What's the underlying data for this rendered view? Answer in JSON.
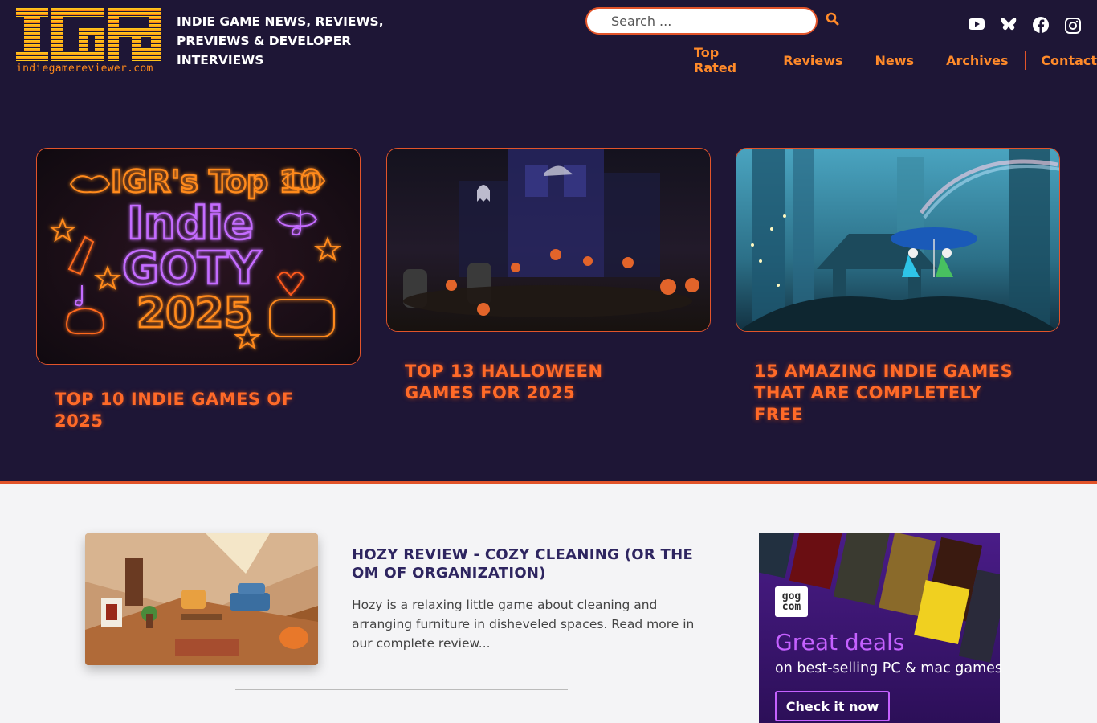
{
  "header": {
    "logo_letters": [
      "I",
      "G",
      "R"
    ],
    "logo_url": "indiegamereviewer.com",
    "tagline": "INDIE GAME NEWS, REVIEWS, PREVIEWS & DEVELOPER INTERVIEWS",
    "search_placeholder": "Search ...",
    "social": [
      "youtube-icon",
      "bluesky-icon",
      "facebook-icon",
      "instagram-icon"
    ],
    "nav": [
      "Top Rated",
      "Reviews",
      "News",
      "Archives",
      "Contact"
    ]
  },
  "features": [
    {
      "title": "TOP 10 INDIE GAMES OF 2025",
      "image_text": {
        "line1": "IGR's Top 10",
        "line2": "Indie",
        "line3": "GOTY",
        "line4": "2025"
      }
    },
    {
      "title": "TOP 13 HALLOWEEN GAMES FOR 2025"
    },
    {
      "title": "15 AMAZING INDIE GAMES THAT ARE COMPLETELY FREE"
    }
  ],
  "article": {
    "title": "HOZY REVIEW - COZY CLEANING (OR THE OM OF ORGANIZATION)",
    "excerpt": "Hozy is a relaxing little game about cleaning and arranging furniture in disheveled spaces. Read more in our complete review..."
  },
  "ad": {
    "brand_top": "gog",
    "brand_bottom": "com",
    "headline": "Great deals",
    "sub": "on best-selling PC & mac games",
    "cta": "Check it now"
  },
  "colors": {
    "bg_dark": "#1e1636",
    "accent": "#e2542a",
    "nav": "#ff8a2a",
    "ad_purple": "#3a1670",
    "ad_pink": "#c561ff"
  }
}
